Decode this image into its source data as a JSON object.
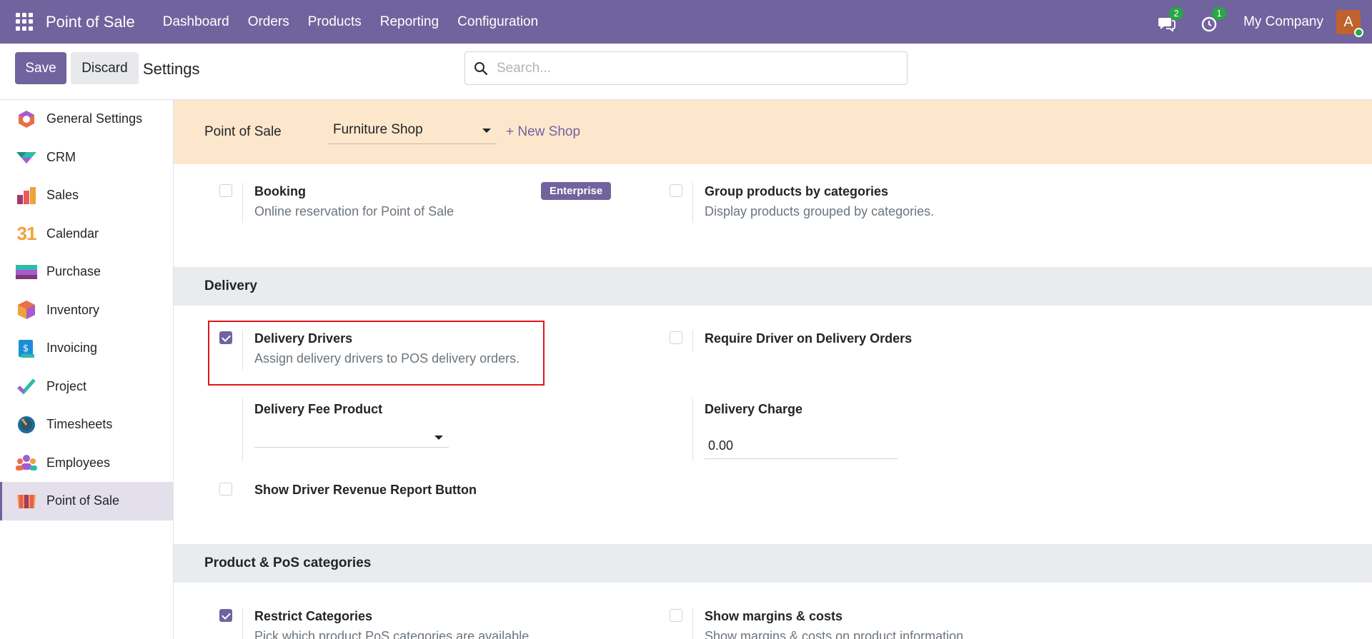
{
  "topbar": {
    "app_name": "Point of Sale",
    "menu": [
      "Dashboard",
      "Orders",
      "Products",
      "Reporting",
      "Configuration"
    ],
    "messages_count": "2",
    "activities_count": "1",
    "company": "My Company",
    "avatar_letter": "A",
    "bg_color": "#71639e"
  },
  "control": {
    "save_label": "Save",
    "discard_label": "Discard",
    "title": "Settings",
    "search_placeholder": "Search..."
  },
  "sidebar": {
    "items": [
      {
        "label": "General Settings",
        "icon": "general-settings-icon"
      },
      {
        "label": "CRM",
        "icon": "crm-icon"
      },
      {
        "label": "Sales",
        "icon": "sales-icon"
      },
      {
        "label": "Calendar",
        "icon": "calendar-icon"
      },
      {
        "label": "Purchase",
        "icon": "purchase-icon"
      },
      {
        "label": "Inventory",
        "icon": "inventory-icon"
      },
      {
        "label": "Invoicing",
        "icon": "invoicing-icon"
      },
      {
        "label": "Project",
        "icon": "project-icon"
      },
      {
        "label": "Timesheets",
        "icon": "timesheets-icon"
      },
      {
        "label": "Employees",
        "icon": "employees-icon"
      },
      {
        "label": "Point of Sale",
        "icon": "point-of-sale-icon",
        "active": true
      }
    ],
    "calendar_glyph": "31"
  },
  "shop": {
    "label": "Point of Sale",
    "selected": "Furniture Shop",
    "new_shop": "+ New Shop"
  },
  "booking": {
    "title": "Booking",
    "desc": "Online reservation for Point of Sale",
    "badge": "Enterprise",
    "checked": false
  },
  "group_products": {
    "title": "Group products by categories",
    "desc": "Display products grouped by categories.",
    "checked": false
  },
  "delivery": {
    "section": "Delivery",
    "drivers_title": "Delivery Drivers",
    "drivers_desc": "Assign delivery drivers to POS delivery orders.",
    "drivers_checked": true,
    "require_driver": "Require Driver on Delivery Orders",
    "require_checked": false,
    "fee_product_label": "Delivery Fee Product",
    "fee_product_value": "",
    "charge_label": "Delivery Charge",
    "charge_value": "0.00",
    "revenue_report": "Show Driver Revenue Report Button",
    "revenue_checked": false
  },
  "categories": {
    "section": "Product & PoS categories",
    "restrict_title": "Restrict Categories",
    "restrict_desc": "Pick which product PoS categories are available",
    "restrict_checked": true,
    "margins_title": "Show margins & costs",
    "margins_desc": "Show margins & costs on product information",
    "margins_checked": false
  },
  "colors": {
    "accent": "#71639e",
    "highlight": "#e2141c",
    "shop_bar": "#fde7cc",
    "badge_green": "#28a745"
  }
}
